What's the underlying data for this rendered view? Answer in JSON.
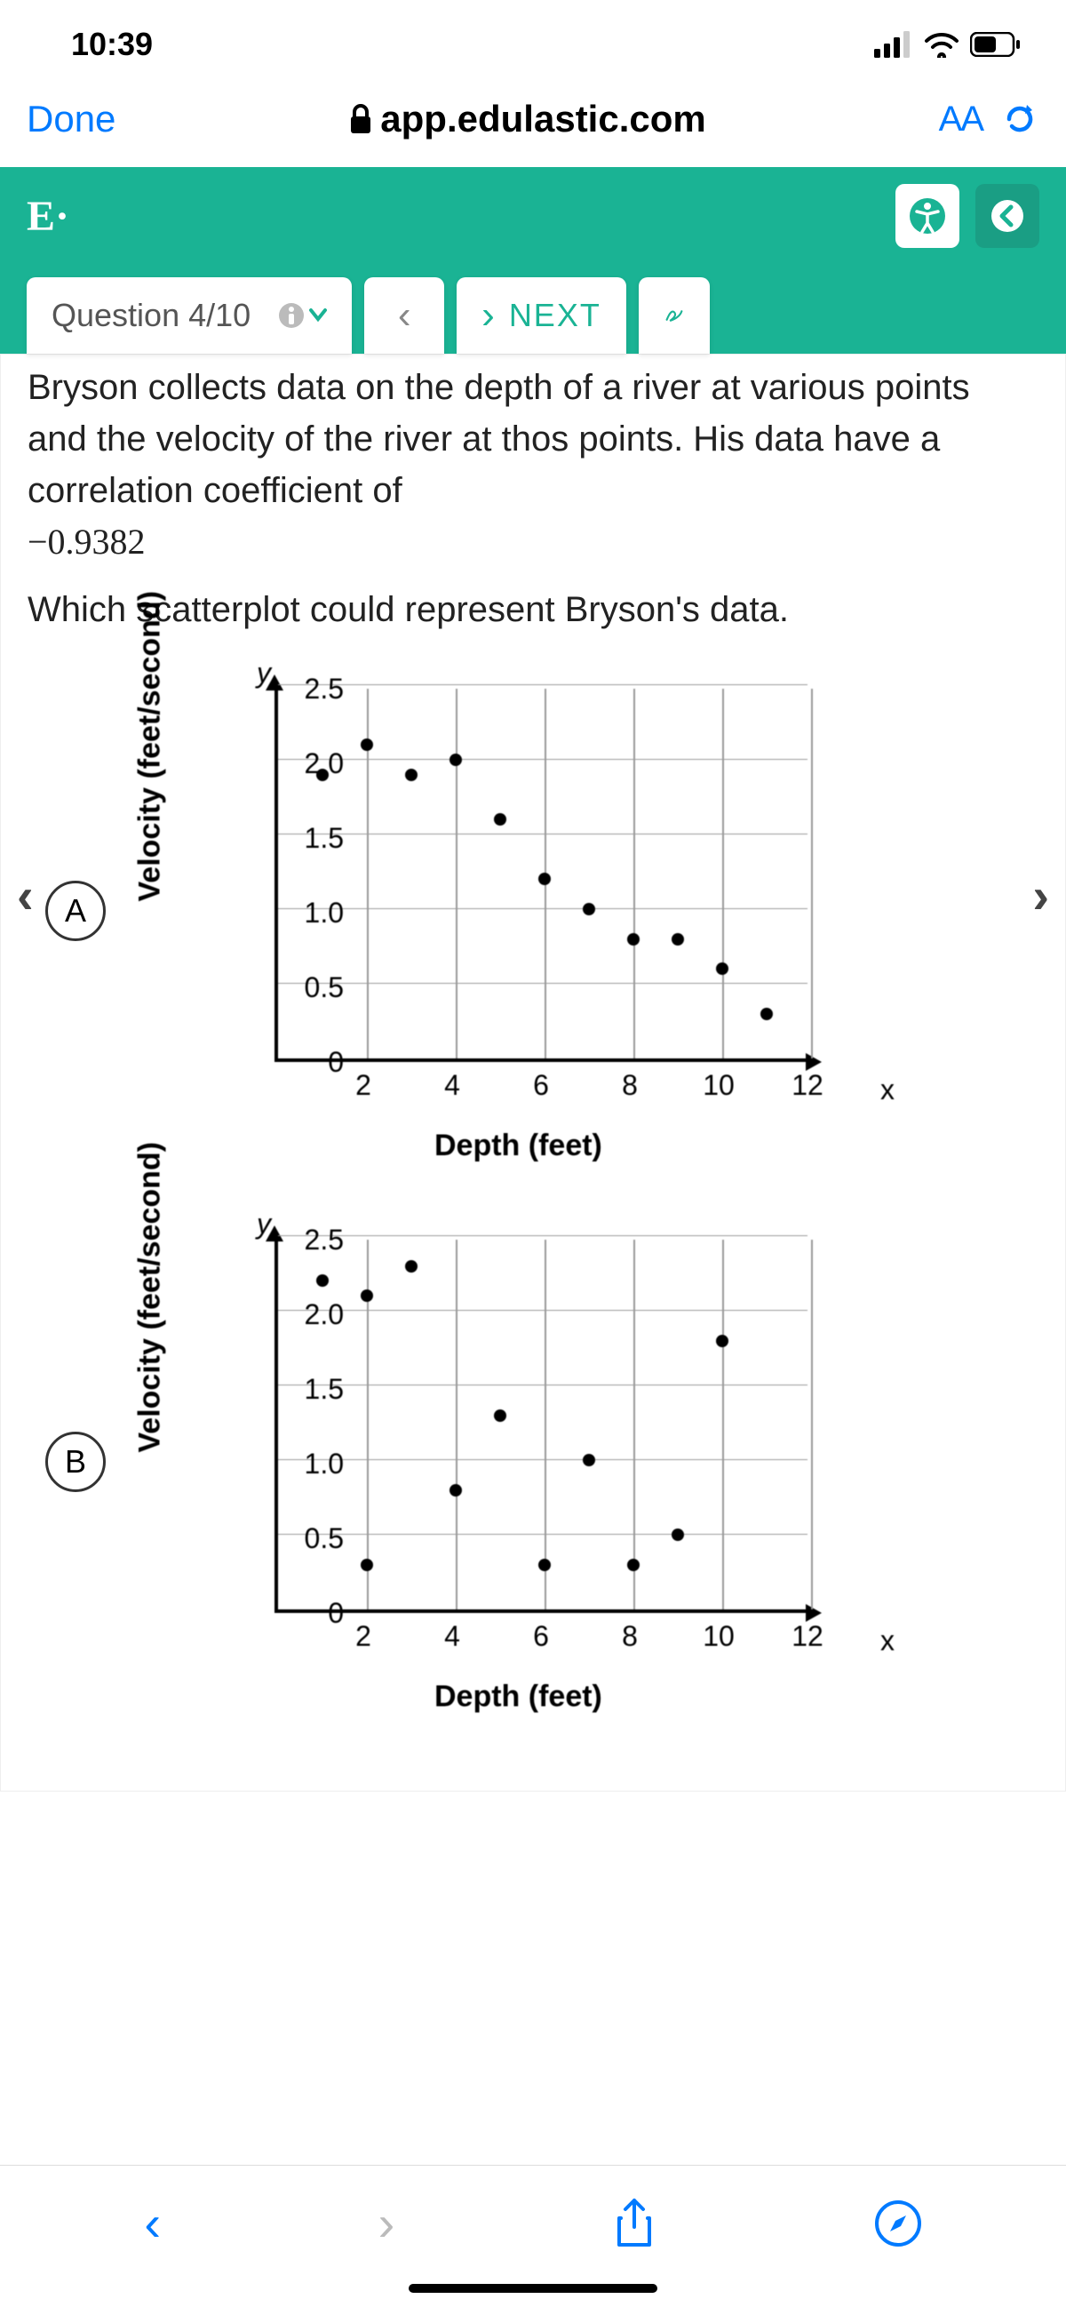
{
  "status_bar": {
    "time": "10:39"
  },
  "browser": {
    "done": "Done",
    "url": "app.edulastic.com",
    "aa": "AA"
  },
  "app_header": {
    "logo": "E·"
  },
  "nav": {
    "question_label": "Question 4/10",
    "prev_symbol": "‹",
    "next_symbol": "›",
    "next_label": "NEXT"
  },
  "question": {
    "text_part1": "Bryson collects data on the depth of a river at various points and the velocity of the river at thos points. His data have a correlation coefficient of ",
    "corr": "−0.9382",
    "text_part2": "Which scatterplot could represent Bryson's data."
  },
  "options": {
    "a": "A",
    "b": "B"
  },
  "chart_common": {
    "y_letter": "y",
    "x_letter": "x",
    "ylabel": "Velocity (feet/second)",
    "xlabel": "Depth (feet)",
    "y_ticks": [
      "2.5",
      "2.0",
      "1.5",
      "1.0",
      "0.5",
      "0"
    ],
    "x_ticks": [
      "2",
      "4",
      "6",
      "8",
      "10",
      "12"
    ]
  },
  "chart_data": [
    {
      "type": "scatter",
      "option": "A",
      "xlabel": "Depth (feet)",
      "ylabel": "Velocity (feet/second)",
      "xlim": [
        0,
        12
      ],
      "ylim": [
        0,
        2.5
      ],
      "points": [
        {
          "x": 1,
          "y": 1.9
        },
        {
          "x": 2,
          "y": 2.1
        },
        {
          "x": 3,
          "y": 1.9
        },
        {
          "x": 4,
          "y": 2.0
        },
        {
          "x": 5,
          "y": 1.6
        },
        {
          "x": 6,
          "y": 1.2
        },
        {
          "x": 7,
          "y": 1.0
        },
        {
          "x": 8,
          "y": 0.8
        },
        {
          "x": 9,
          "y": 0.8
        },
        {
          "x": 10,
          "y": 0.6
        },
        {
          "x": 11,
          "y": 0.3
        }
      ]
    },
    {
      "type": "scatter",
      "option": "B",
      "xlabel": "Depth (feet)",
      "ylabel": "Velocity (feet/second)",
      "xlim": [
        0,
        12
      ],
      "ylim": [
        0,
        2.5
      ],
      "points": [
        {
          "x": 1,
          "y": 2.2
        },
        {
          "x": 2,
          "y": 2.1
        },
        {
          "x": 3,
          "y": 2.3
        },
        {
          "x": 2,
          "y": 0.3
        },
        {
          "x": 4,
          "y": 0.8
        },
        {
          "x": 5,
          "y": 1.3
        },
        {
          "x": 6,
          "y": 0.3
        },
        {
          "x": 7,
          "y": 1.0
        },
        {
          "x": 8,
          "y": 0.3
        },
        {
          "x": 9,
          "y": 0.5
        },
        {
          "x": 10,
          "y": 1.8
        }
      ]
    }
  ]
}
